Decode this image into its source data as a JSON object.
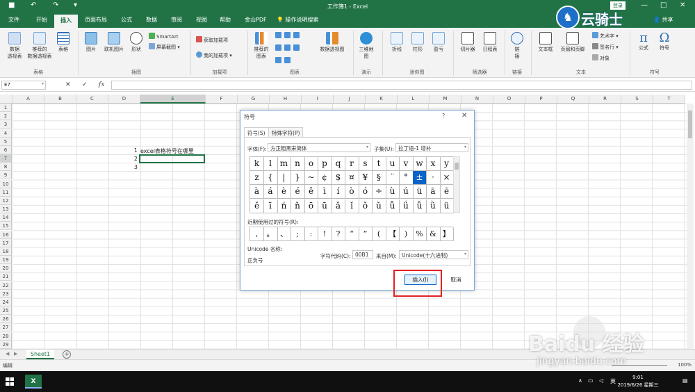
{
  "titlebar": {
    "title": "工作簿1 - Excel",
    "login": "登录",
    "save_icon": "■",
    "undo_icon": "↶",
    "redo_icon": "↷",
    "more_icon": "▾",
    "min_icon": "—",
    "max_icon": "□",
    "close_icon": "✕"
  },
  "tabs": [
    "文件",
    "开始",
    "插入",
    "页面布局",
    "公式",
    "数据",
    "审阅",
    "视图",
    "帮助",
    "金山PDF",
    "操作说明搜索"
  ],
  "active_tab": "插入",
  "share": "共享",
  "ribbon": {
    "groups": [
      "表格",
      "插图",
      "加载项",
      "图表",
      "演示",
      "迷你图",
      "筛选器",
      "链接",
      "文本",
      "符号"
    ],
    "buttons": {
      "pivot": "数据\n透视表",
      "rec_pivot": "推荐的\n数据透视表",
      "table": "表格",
      "picture": "图片",
      "online_picture": "联机图片",
      "shapes": "形状",
      "smartart": "SmartArt",
      "screenshot": "屏幕截图",
      "get_addins": "获取加载项",
      "my_addins": "我的加载项",
      "rec_charts": "推荐的\n图表",
      "pivot_chart": "数据透视图",
      "map3d": "三维地\n图",
      "spark_line": "折线",
      "spark_col": "柱形",
      "spark_wl": "盈亏",
      "slicer": "切片器",
      "timeline": "日程表",
      "link": "链\n接",
      "textbox": "文本框",
      "header_footer": "页眉和页脚",
      "wordart": "艺术字",
      "signature": "签名行",
      "object": "对象",
      "equation": "公式",
      "symbol": "符号"
    }
  },
  "formula_bar": {
    "name_box": "E7",
    "cancel": "✕",
    "enter": "✓",
    "fx": "fx",
    "value": ""
  },
  "columns": [
    "A",
    "B",
    "C",
    "D",
    "E",
    "F",
    "G",
    "H",
    "I",
    "J",
    "K",
    "L",
    "M",
    "N",
    "O",
    "P",
    "Q",
    "R",
    "S",
    "T"
  ],
  "rows": [
    "1",
    "2",
    "3",
    "4",
    "5",
    "6",
    "7",
    "8",
    "9",
    "10",
    "11",
    "12",
    "13",
    "14",
    "15",
    "16",
    "17",
    "18",
    "19",
    "20",
    "21",
    "22",
    "23",
    "24",
    "25",
    "26",
    "27",
    "28",
    "29"
  ],
  "cells": {
    "d6": "1",
    "e6": "excel表格符号在哪里",
    "d7": "2",
    "d8": "3"
  },
  "sheet": {
    "name": "Sheet1",
    "add": "+"
  },
  "status": {
    "mode": "编辑",
    "zoom": "100%"
  },
  "taskbar": {
    "app": "X",
    "ime": "英",
    "time": "9:01",
    "date": "2019/6/26 星期三",
    "tray_up": "∧"
  },
  "watermarks": {
    "brand": "云骑士",
    "baidu": "Baidu 经验",
    "url": "jingyan.baidu.com"
  },
  "dialog": {
    "title": "符号",
    "help": "?",
    "close": "✕",
    "tabs": [
      "符号(S)",
      "特殊字符(P)"
    ],
    "font_label": "字体(F):",
    "font_value": "方正粗黑宋简体",
    "subset_label": "子集(U):",
    "subset_value": "拉丁语-1 增补",
    "symbols": [
      [
        "k",
        "l",
        "m",
        "n",
        "o",
        "p",
        "q",
        "r",
        "s",
        "t",
        "u",
        "v",
        "w",
        "x",
        "y"
      ],
      [
        "z",
        "{",
        "|",
        "}",
        "~",
        "¢",
        "$",
        "¤",
        "¥",
        "§",
        "¨",
        "°",
        "±",
        "·",
        "×"
      ],
      [
        "à",
        "á",
        "è",
        "é",
        "ê",
        "ì",
        "í",
        "ò",
        "ó",
        "÷",
        "ù",
        "ú",
        "ü",
        "ā",
        "ē"
      ],
      [
        "ě",
        "ī",
        "ń",
        "ň",
        "ō",
        "ū",
        "ǎ",
        "ǐ",
        "ǒ",
        "ǔ",
        "ǖ",
        "ǘ",
        "ǚ",
        "ǜ",
        "ü"
      ]
    ],
    "selected_symbol": "±",
    "recent_label": "近期使用过的符号(R):",
    "recent": [
      ",",
      "。",
      "、",
      ";",
      ":",
      "!",
      "?",
      "“",
      "”",
      "(",
      "【",
      ")",
      "%",
      "&",
      "】"
    ],
    "unicode_name_label": "Unicode 名称:",
    "unicode_name": "正负号",
    "charcode_label": "字符代码(C):",
    "charcode": "00B1",
    "from_label": "来自(M):",
    "from_value": "Unicode(十六进制)",
    "insert": "插入(I)",
    "cancel": "取消"
  },
  "colors": {
    "excel_green": "#217346",
    "highlight": "#e02020",
    "selection": "#0a64c8"
  }
}
